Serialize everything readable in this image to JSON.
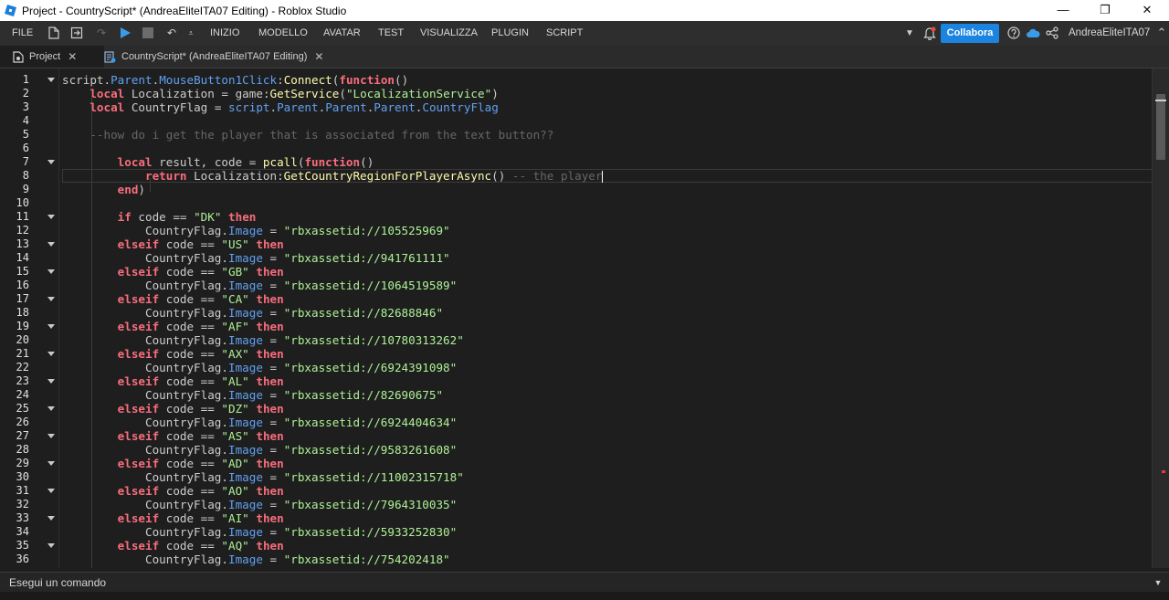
{
  "window": {
    "title": "Project - CountryScript* (AndreaEliteITA07 Editing) - Roblox Studio",
    "minimize": "—",
    "restore": "❐",
    "close": "✕"
  },
  "menubar": {
    "file": "FILE",
    "menus": [
      "INIZIO",
      "MODELLO",
      "AVATAR",
      "TEST",
      "VISUALIZZA",
      "PLUGIN",
      "SCRIPT"
    ],
    "collaborate_label": "Collabora",
    "username": "AndreaEliteITA07"
  },
  "tabs": [
    {
      "label": "Project",
      "close": "✕"
    },
    {
      "label": "CountryScript* (AndreaEliteITA07 Editing)",
      "close": "✕"
    }
  ],
  "command_bar": {
    "placeholder": "Esegui un comando"
  },
  "editor": {
    "line_numbers": [
      "1",
      "2",
      "3",
      "4",
      "5",
      "6",
      "7",
      "8",
      "9",
      "10",
      "11",
      "12",
      "13",
      "14",
      "15",
      "16",
      "17",
      "18",
      "19",
      "20",
      "21",
      "22",
      "23",
      "24",
      "25",
      "26",
      "27",
      "28",
      "29",
      "30",
      "31",
      "32",
      "33",
      "34",
      "35",
      "36"
    ],
    "fold_lines": [
      1,
      7,
      11,
      13,
      15,
      17,
      19,
      21,
      23,
      25,
      27,
      29,
      31,
      33,
      35
    ],
    "current_line": 8,
    "code_lines": [
      [
        [
          "tx",
          "script"
        ],
        [
          "tx",
          "."
        ],
        [
          "pr",
          "Parent"
        ],
        [
          "tx",
          "."
        ],
        [
          "pr",
          "MouseButton1Click"
        ],
        [
          "tx",
          ":"
        ],
        [
          "fn",
          "Connect"
        ],
        [
          "tx",
          "("
        ],
        [
          "kw",
          "function"
        ],
        [
          "tx",
          "()"
        ]
      ],
      [
        [
          "tx",
          "    "
        ],
        [
          "kw",
          "local"
        ],
        [
          "tx",
          " Localization = "
        ],
        [
          "tx",
          "game"
        ],
        [
          "tx",
          ":"
        ],
        [
          "fn",
          "GetService"
        ],
        [
          "tx",
          "("
        ],
        [
          "st",
          "\"LocalizationService\""
        ],
        [
          "tx",
          ")"
        ]
      ],
      [
        [
          "tx",
          "    "
        ],
        [
          "kw",
          "local"
        ],
        [
          "tx",
          " CountryFlag = "
        ],
        [
          "pr",
          "script"
        ],
        [
          "tx",
          "."
        ],
        [
          "pr",
          "Parent"
        ],
        [
          "tx",
          "."
        ],
        [
          "pr",
          "Parent"
        ],
        [
          "tx",
          "."
        ],
        [
          "pr",
          "Parent"
        ],
        [
          "tx",
          "."
        ],
        [
          "pr",
          "CountryFlag"
        ]
      ],
      [],
      [
        [
          "tx",
          "    "
        ],
        [
          "cm",
          "--how do i get the player that is associated from the text button??"
        ]
      ],
      [],
      [
        [
          "tx",
          "        "
        ],
        [
          "kw",
          "local"
        ],
        [
          "tx",
          " result, code = "
        ],
        [
          "fn",
          "pcall"
        ],
        [
          "tx",
          "("
        ],
        [
          "kw",
          "function"
        ],
        [
          "tx",
          "()"
        ]
      ],
      [
        [
          "tx",
          "            "
        ],
        [
          "kw",
          "return"
        ],
        [
          "tx",
          " Localization:"
        ],
        [
          "fn",
          "GetCountryRegionForPlayerAsync"
        ],
        [
          "tx",
          "() "
        ],
        [
          "cm",
          "-- the player"
        ]
      ],
      [
        [
          "tx",
          "        "
        ],
        [
          "kw",
          "end"
        ],
        [
          "tx",
          ")"
        ]
      ],
      [],
      [
        [
          "tx",
          "        "
        ],
        [
          "kw",
          "if"
        ],
        [
          "tx",
          " code == "
        ],
        [
          "st",
          "\"DK\""
        ],
        [
          "tx",
          " "
        ],
        [
          "kw",
          "then"
        ]
      ],
      [
        [
          "tx",
          "            CountryFlag."
        ],
        [
          "pr",
          "Image"
        ],
        [
          "tx",
          " = "
        ],
        [
          "st",
          "\"rbxassetid://105525969\""
        ]
      ],
      [
        [
          "tx",
          "        "
        ],
        [
          "kw",
          "elseif"
        ],
        [
          "tx",
          " code == "
        ],
        [
          "st",
          "\"US\""
        ],
        [
          "tx",
          " "
        ],
        [
          "kw",
          "then"
        ]
      ],
      [
        [
          "tx",
          "            CountryFlag."
        ],
        [
          "pr",
          "Image"
        ],
        [
          "tx",
          " = "
        ],
        [
          "st",
          "\"rbxassetid://941761111\""
        ]
      ],
      [
        [
          "tx",
          "        "
        ],
        [
          "kw",
          "elseif"
        ],
        [
          "tx",
          " code == "
        ],
        [
          "st",
          "\"GB\""
        ],
        [
          "tx",
          " "
        ],
        [
          "kw",
          "then"
        ]
      ],
      [
        [
          "tx",
          "            CountryFlag."
        ],
        [
          "pr",
          "Image"
        ],
        [
          "tx",
          " = "
        ],
        [
          "st",
          "\"rbxassetid://1064519589\""
        ]
      ],
      [
        [
          "tx",
          "        "
        ],
        [
          "kw",
          "elseif"
        ],
        [
          "tx",
          " code == "
        ],
        [
          "st",
          "\"CA\""
        ],
        [
          "tx",
          " "
        ],
        [
          "kw",
          "then"
        ]
      ],
      [
        [
          "tx",
          "            CountryFlag."
        ],
        [
          "pr",
          "Image"
        ],
        [
          "tx",
          " = "
        ],
        [
          "st",
          "\"rbxassetid://82688846\""
        ]
      ],
      [
        [
          "tx",
          "        "
        ],
        [
          "kw",
          "elseif"
        ],
        [
          "tx",
          " code == "
        ],
        [
          "st",
          "\"AF\""
        ],
        [
          "tx",
          " "
        ],
        [
          "kw",
          "then"
        ]
      ],
      [
        [
          "tx",
          "            CountryFlag."
        ],
        [
          "pr",
          "Image"
        ],
        [
          "tx",
          " = "
        ],
        [
          "st",
          "\"rbxassetid://10780313262\""
        ]
      ],
      [
        [
          "tx",
          "        "
        ],
        [
          "kw",
          "elseif"
        ],
        [
          "tx",
          " code == "
        ],
        [
          "st",
          "\"AX\""
        ],
        [
          "tx",
          " "
        ],
        [
          "kw",
          "then"
        ]
      ],
      [
        [
          "tx",
          "            CountryFlag."
        ],
        [
          "pr",
          "Image"
        ],
        [
          "tx",
          " = "
        ],
        [
          "st",
          "\"rbxassetid://6924391098\""
        ]
      ],
      [
        [
          "tx",
          "        "
        ],
        [
          "kw",
          "elseif"
        ],
        [
          "tx",
          " code == "
        ],
        [
          "st",
          "\"AL\""
        ],
        [
          "tx",
          " "
        ],
        [
          "kw",
          "then"
        ]
      ],
      [
        [
          "tx",
          "            CountryFlag."
        ],
        [
          "pr",
          "Image"
        ],
        [
          "tx",
          " = "
        ],
        [
          "st",
          "\"rbxassetid://82690675\""
        ]
      ],
      [
        [
          "tx",
          "        "
        ],
        [
          "kw",
          "elseif"
        ],
        [
          "tx",
          " code == "
        ],
        [
          "st",
          "\"DZ\""
        ],
        [
          "tx",
          " "
        ],
        [
          "kw",
          "then"
        ]
      ],
      [
        [
          "tx",
          "            CountryFlag."
        ],
        [
          "pr",
          "Image"
        ],
        [
          "tx",
          " = "
        ],
        [
          "st",
          "\"rbxassetid://6924404634\""
        ]
      ],
      [
        [
          "tx",
          "        "
        ],
        [
          "kw",
          "elseif"
        ],
        [
          "tx",
          " code == "
        ],
        [
          "st",
          "\"AS\""
        ],
        [
          "tx",
          " "
        ],
        [
          "kw",
          "then"
        ]
      ],
      [
        [
          "tx",
          "            CountryFlag."
        ],
        [
          "pr",
          "Image"
        ],
        [
          "tx",
          " = "
        ],
        [
          "st",
          "\"rbxassetid://9583261608\""
        ]
      ],
      [
        [
          "tx",
          "        "
        ],
        [
          "kw",
          "elseif"
        ],
        [
          "tx",
          " code == "
        ],
        [
          "st",
          "\"AD\""
        ],
        [
          "tx",
          " "
        ],
        [
          "kw",
          "then"
        ]
      ],
      [
        [
          "tx",
          "            CountryFlag."
        ],
        [
          "pr",
          "Image"
        ],
        [
          "tx",
          " = "
        ],
        [
          "st",
          "\"rbxassetid://11002315718\""
        ]
      ],
      [
        [
          "tx",
          "        "
        ],
        [
          "kw",
          "elseif"
        ],
        [
          "tx",
          " code == "
        ],
        [
          "st",
          "\"AO\""
        ],
        [
          "tx",
          " "
        ],
        [
          "kw",
          "then"
        ]
      ],
      [
        [
          "tx",
          "            CountryFlag."
        ],
        [
          "pr",
          "Image"
        ],
        [
          "tx",
          " = "
        ],
        [
          "st",
          "\"rbxassetid://7964310035\""
        ]
      ],
      [
        [
          "tx",
          "        "
        ],
        [
          "kw",
          "elseif"
        ],
        [
          "tx",
          " code == "
        ],
        [
          "st",
          "\"AI\""
        ],
        [
          "tx",
          " "
        ],
        [
          "kw",
          "then"
        ]
      ],
      [
        [
          "tx",
          "            CountryFlag."
        ],
        [
          "pr",
          "Image"
        ],
        [
          "tx",
          " = "
        ],
        [
          "st",
          "\"rbxassetid://5933252830\""
        ]
      ],
      [
        [
          "tx",
          "        "
        ],
        [
          "kw",
          "elseif"
        ],
        [
          "tx",
          " code == "
        ],
        [
          "st",
          "\"AQ\""
        ],
        [
          "tx",
          " "
        ],
        [
          "kw",
          "then"
        ]
      ],
      [
        [
          "tx",
          "            CountryFlag."
        ],
        [
          "pr",
          "Image"
        ],
        [
          "tx",
          " = "
        ],
        [
          "st",
          "\"rbxassetid://754202418\""
        ]
      ]
    ]
  }
}
